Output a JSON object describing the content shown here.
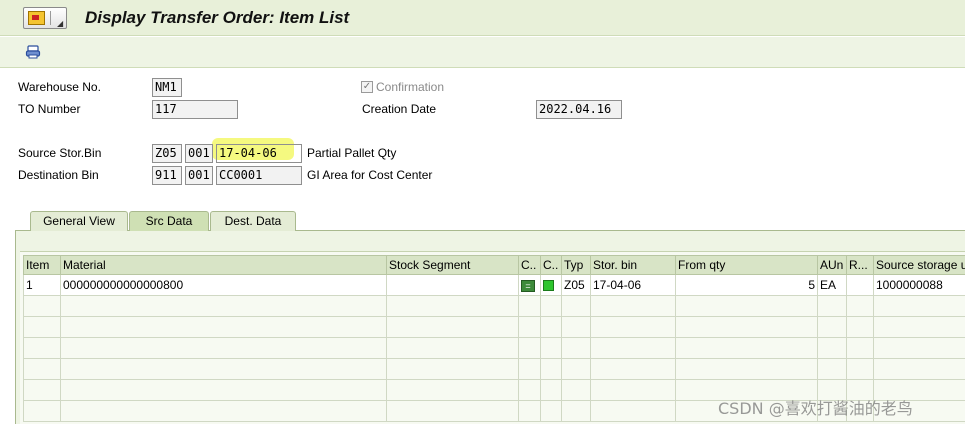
{
  "window": {
    "title": "Display Transfer Order: Item List"
  },
  "toolbar": {
    "icons": [
      "menu-icon",
      "print-icon"
    ]
  },
  "header": {
    "warehouse_label": "Warehouse No.",
    "warehouse_value": "NM1",
    "to_number_label": "TO Number",
    "to_number_value": "117",
    "confirmation_label": "Confirmation",
    "confirmation_checked": true,
    "creation_date_label": "Creation Date",
    "creation_date_value": "2022.04.16"
  },
  "bins": {
    "source_label": "Source Stor.Bin",
    "source_type": "Z05",
    "source_section": "001",
    "source_bin": "17-04-06",
    "source_desc": "Partial Pallet Qty",
    "dest_label": "Destination Bin",
    "dest_type": "911",
    "dest_section": "001",
    "dest_bin": "CC0001",
    "dest_desc": "GI Area for Cost Center"
  },
  "tabs": [
    {
      "label": "General View",
      "active": false
    },
    {
      "label": "Src Data",
      "active": true
    },
    {
      "label": "Dest. Data",
      "active": false
    }
  ],
  "table": {
    "columns": [
      "Item",
      "Material",
      "Stock Segment",
      "C..",
      "C..",
      "Typ",
      "Stor. bin",
      "From qty",
      "AUn",
      "R...",
      "Source storage u"
    ],
    "rows": [
      {
        "item": "1",
        "material": "000000000000000800",
        "stock_segment": "",
        "c1": "=",
        "c2": "green",
        "typ": "Z05",
        "stor_bin": "17-04-06",
        "from_qty": "5",
        "aun": "EA",
        "r": "",
        "source_storage": "1000000088"
      }
    ]
  },
  "watermark": "CSDN @喜欢打酱油的老鸟"
}
